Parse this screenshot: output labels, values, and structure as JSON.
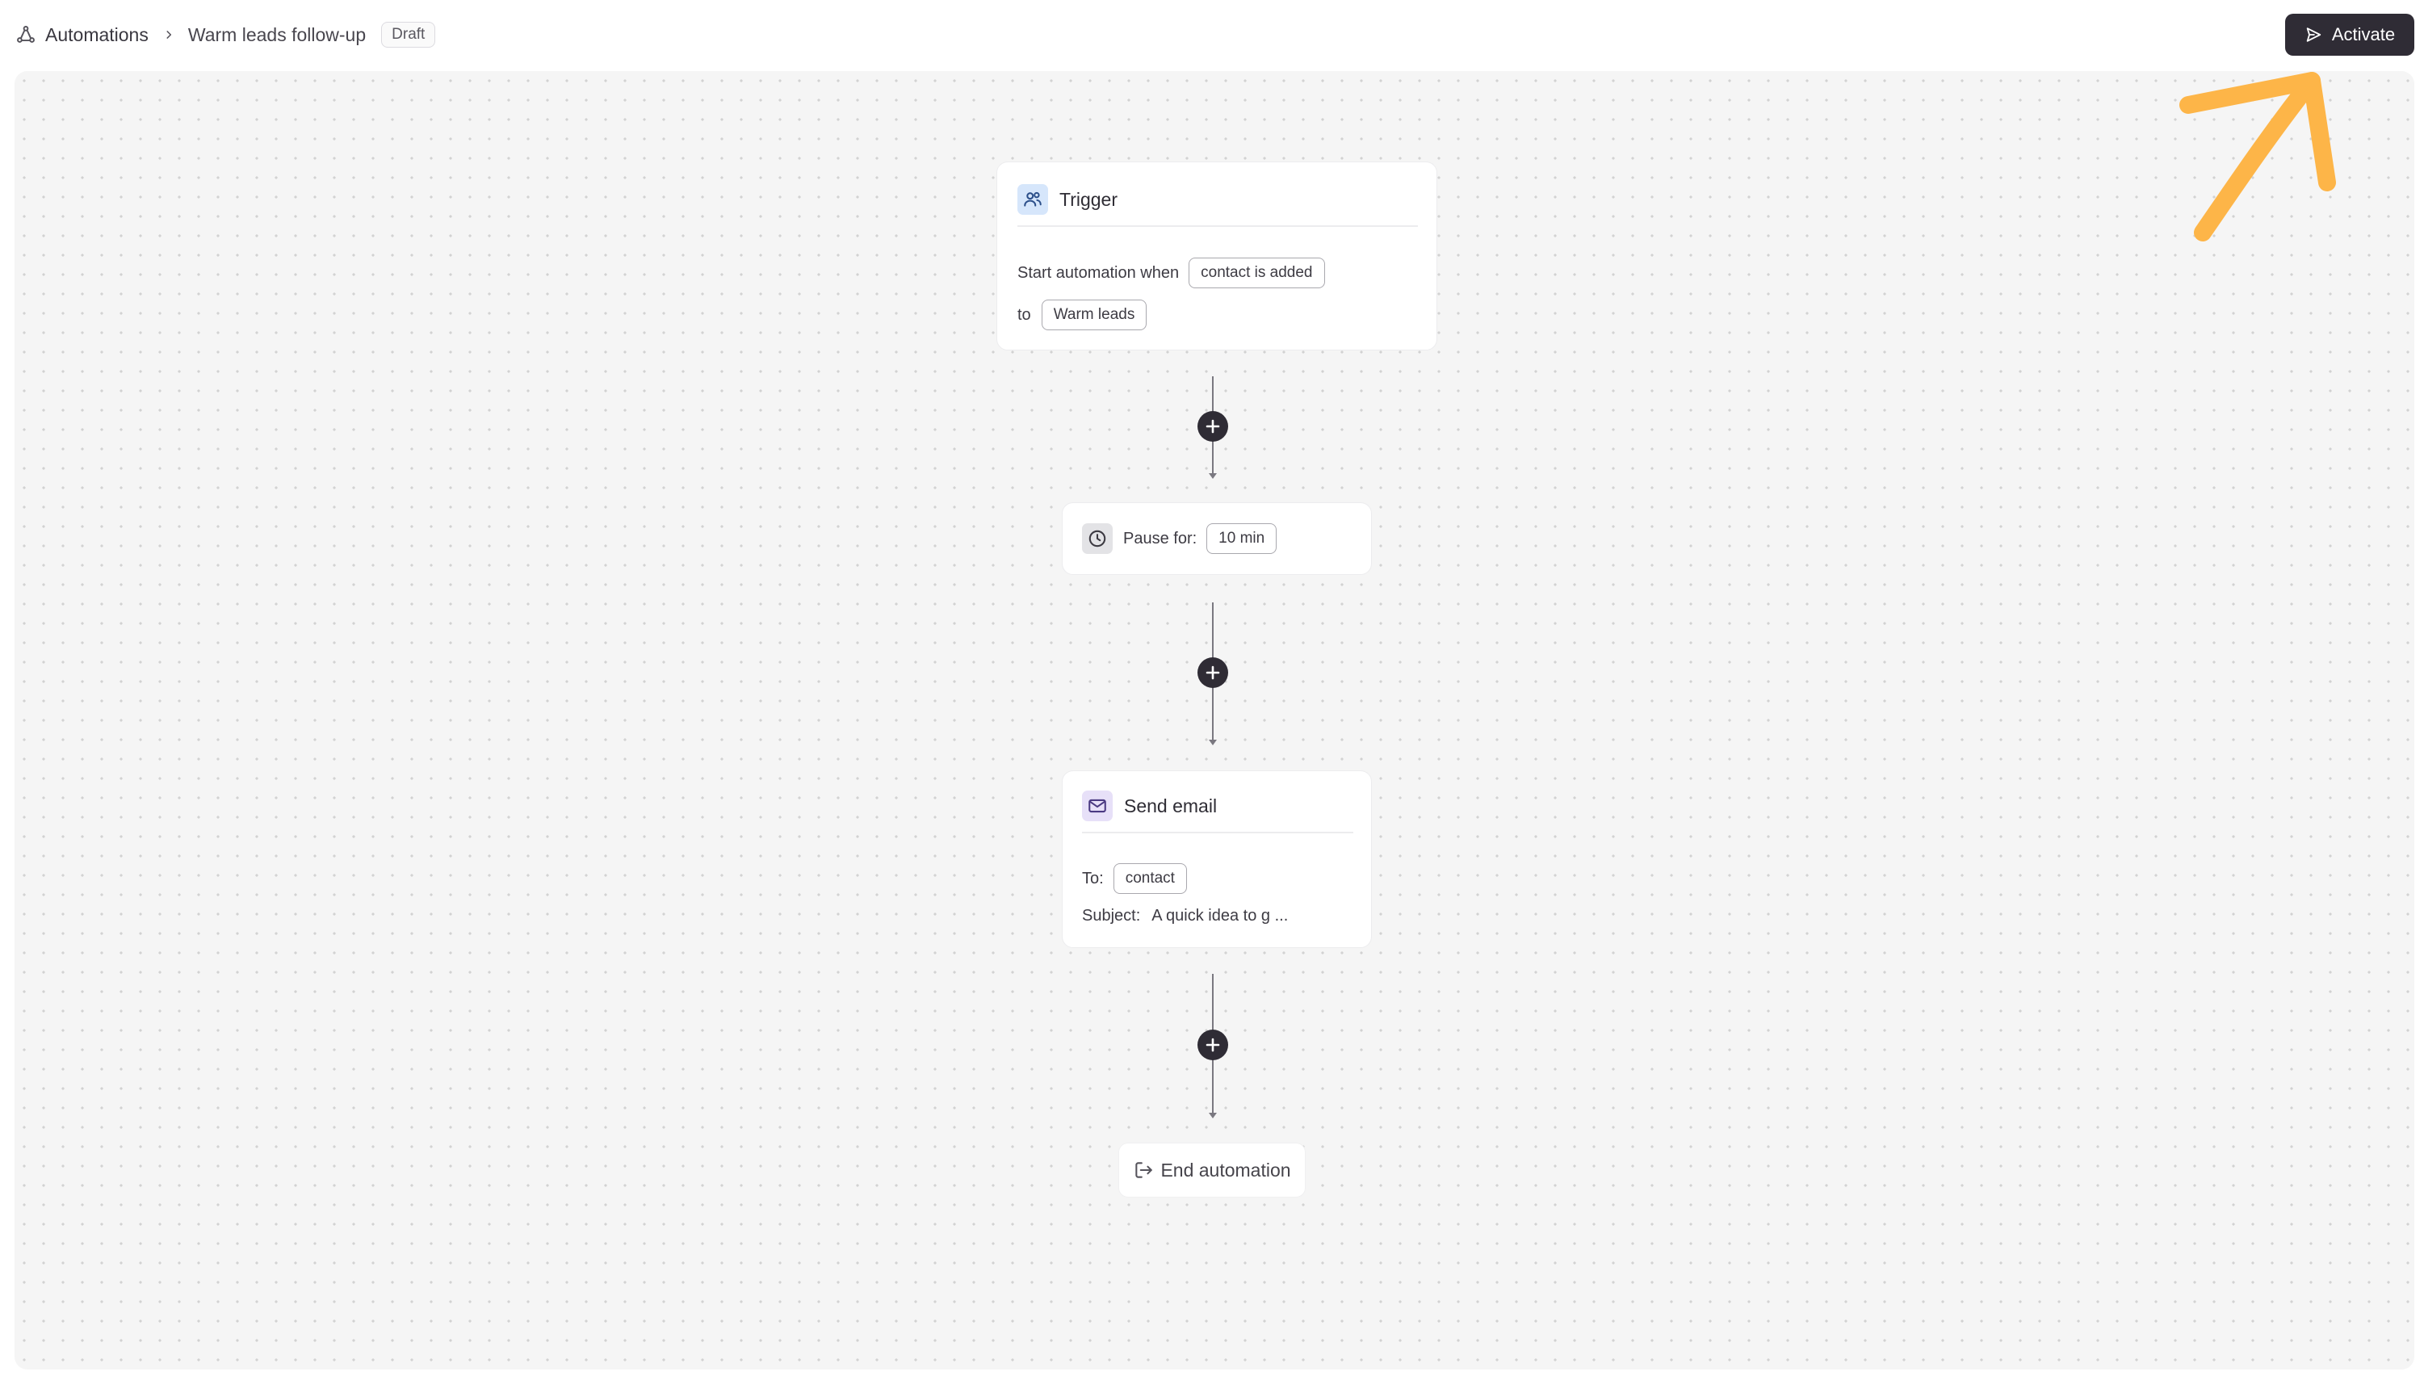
{
  "header": {
    "breadcrumb_root": "Automations",
    "breadcrumb_current": "Warm leads follow-up",
    "status_badge": "Draft",
    "activate_label": "Activate"
  },
  "flow": {
    "trigger": {
      "title": "Trigger",
      "line1_text": "Start automation when",
      "event_value": "contact is added",
      "line2_text": "to",
      "list_value": "Warm leads"
    },
    "pause": {
      "label": "Pause for:",
      "duration_value": "10 min"
    },
    "send_email": {
      "title": "Send email",
      "to_label": "To:",
      "to_value": "contact",
      "subject_label": "Subject:",
      "subject_value": "A quick idea to g ..."
    },
    "end": {
      "label": "End automation"
    }
  },
  "icons": {
    "breadcrumb": "automation-icon",
    "separator": "chevron-right-icon",
    "activate": "send-icon",
    "trigger": "users-icon",
    "pause": "clock-icon",
    "email": "mail-icon",
    "add_step": "plus-icon",
    "end": "exit-icon",
    "annotation": "arrow-annotation"
  },
  "colors": {
    "primary_button": "#2f2c35",
    "trigger_chip": "#d6e6fb",
    "pause_chip": "#e3e3e6",
    "email_chip": "#e7e0f8",
    "annotation_arrow": "#fdb548",
    "canvas_background": "#f5f5f5"
  }
}
